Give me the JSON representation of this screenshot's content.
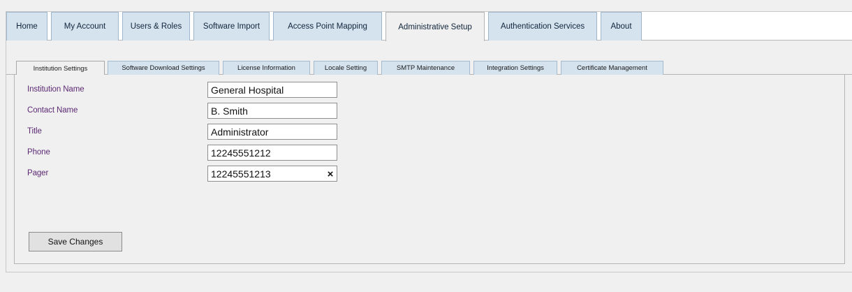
{
  "top_tabs": [
    {
      "label": "Home"
    },
    {
      "label": "My Account"
    },
    {
      "label": "Users & Roles"
    },
    {
      "label": "Software Import"
    },
    {
      "label": "Access Point Mapping"
    },
    {
      "label": "Administrative Setup",
      "active": true
    },
    {
      "label": "Authentication Services"
    },
    {
      "label": "About"
    }
  ],
  "sub_tabs": [
    {
      "label": "Institution Settings",
      "active": true
    },
    {
      "label": "Software Download Settings"
    },
    {
      "label": "License Information"
    },
    {
      "label": "Locale Setting"
    },
    {
      "label": "SMTP Maintenance"
    },
    {
      "label": "Integration Settings"
    },
    {
      "label": "Certificate Management"
    }
  ],
  "form": {
    "fields": [
      {
        "label": "Institution Name",
        "value": "General Hospital"
      },
      {
        "label": "Contact Name",
        "value": "B. Smith"
      },
      {
        "label": "Title",
        "value": "Administrator"
      },
      {
        "label": "Phone",
        "value": "12245551212"
      },
      {
        "label": "Pager",
        "value": "12245551213"
      }
    ],
    "clear_icon": "×",
    "save_label": "Save Changes"
  },
  "colors": {
    "tab_bg": "#d5e3ef",
    "label_text": "#5b2a73",
    "panel_bg": "#f0f0f0"
  }
}
